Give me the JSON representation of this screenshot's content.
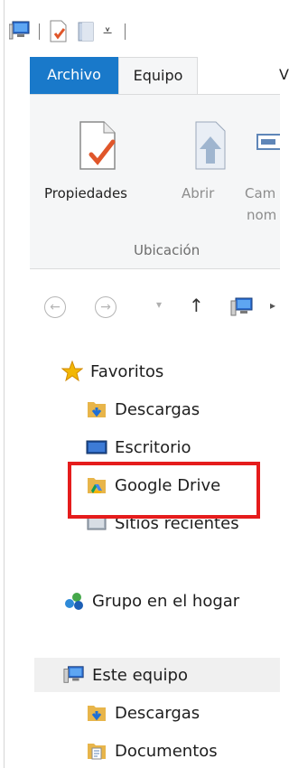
{
  "ribbon": {
    "tabs": {
      "archivo": "Archivo",
      "equipo": "Equipo",
      "vista": "V"
    },
    "propiedades": "Propiedades",
    "abrir": "Abrir",
    "cambiar_line1": "Cam",
    "cambiar_line2": "nom",
    "group_ubicacion": "Ubicación"
  },
  "nav": {
    "back": "←",
    "forward": "→",
    "recent": "▾",
    "up": "↑",
    "chevron": "▸"
  },
  "tree": {
    "favoritos": "Favoritos",
    "descargas": "Descargas",
    "escritorio": "Escritorio",
    "google_drive": "Google Drive",
    "sitios_recientes": "Sitios recientes",
    "grupo_hogar": "Grupo en el hogar",
    "este_equipo": "Este equipo",
    "descargas2": "Descargas",
    "documentos": "Documentos"
  },
  "colors": {
    "archivo_tab": "#1979ca",
    "highlight": "#e51c1c",
    "star": "#f2b705",
    "folder": "#e8b54a"
  }
}
